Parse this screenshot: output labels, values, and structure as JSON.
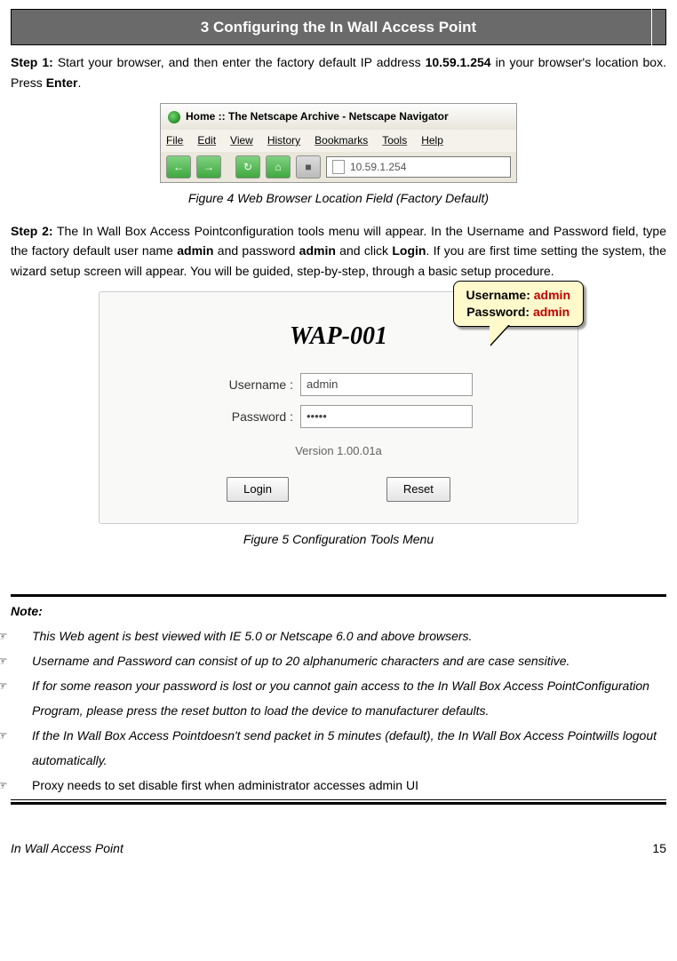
{
  "header": {
    "title": "3 Configuring the In Wall Access Point"
  },
  "step1": {
    "label": "Step 1:",
    "text_a": " Start your browser, and then enter the factory default IP address ",
    "ip": "10.59.1.254",
    "text_b": " in your browser's location box. Press ",
    "enter": "Enter",
    "period": "."
  },
  "browser": {
    "title": "Home :: The Netscape Archive - Netscape Navigator",
    "menu": [
      "File",
      "Edit",
      "View",
      "History",
      "Bookmarks",
      "Tools",
      "Help"
    ],
    "nav": {
      "back": "←",
      "fwd": "→",
      "reload": "↻",
      "home": "⌂",
      "stop": "■"
    },
    "addr": "10.59.1.254"
  },
  "fig4_caption": "Figure 4 Web Browser Location Field (Factory Default)",
  "step2": {
    "label": "Step 2:",
    "text_a": " The In Wall Box Access Pointconfiguration tools menu will appear. In the Username and Password field, type the factory default user name ",
    "admin1": "admin",
    "text_b": " and password ",
    "admin2": "admin",
    "text_c": " and click ",
    "login": "Login",
    "text_d": ". If you are first time setting the system, the wizard setup screen will appear. You will be guided, step-by-step, through a basic setup procedure."
  },
  "callout": {
    "user_label": "Username: ",
    "user_val": "admin",
    "pass_label": "Password: ",
    "pass_val": "admin"
  },
  "login": {
    "title": "WAP-001",
    "user_label": "Username :",
    "user_value": "admin",
    "pass_label": "Password :",
    "pass_value": "•••••",
    "version": "Version 1.00.01a",
    "login_btn": "Login",
    "reset_btn": "Reset"
  },
  "fig5_caption": "Figure 5 Configuration Tools Menu",
  "notes": {
    "heading": "Note:",
    "items": [
      "This Web agent is best viewed with IE 5.0 or Netscape 6.0 and above browsers.",
      "Username and Password can consist of up to 20 alphanumeric characters and are case sensitive.",
      "If for some reason your password is lost or you cannot gain access to the In Wall Box Access PointConfiguration Program, please press the reset button to load the device to manufacturer defaults.",
      "If the In Wall Box Access Pointdoesn't send packet in 5 minutes (default), the In Wall Box Access Pointwills logout automatically."
    ],
    "last": "Proxy needs to set disable first when administrator accesses admin UI"
  },
  "footer": {
    "left": "In Wall Access Point",
    "page": "15"
  }
}
